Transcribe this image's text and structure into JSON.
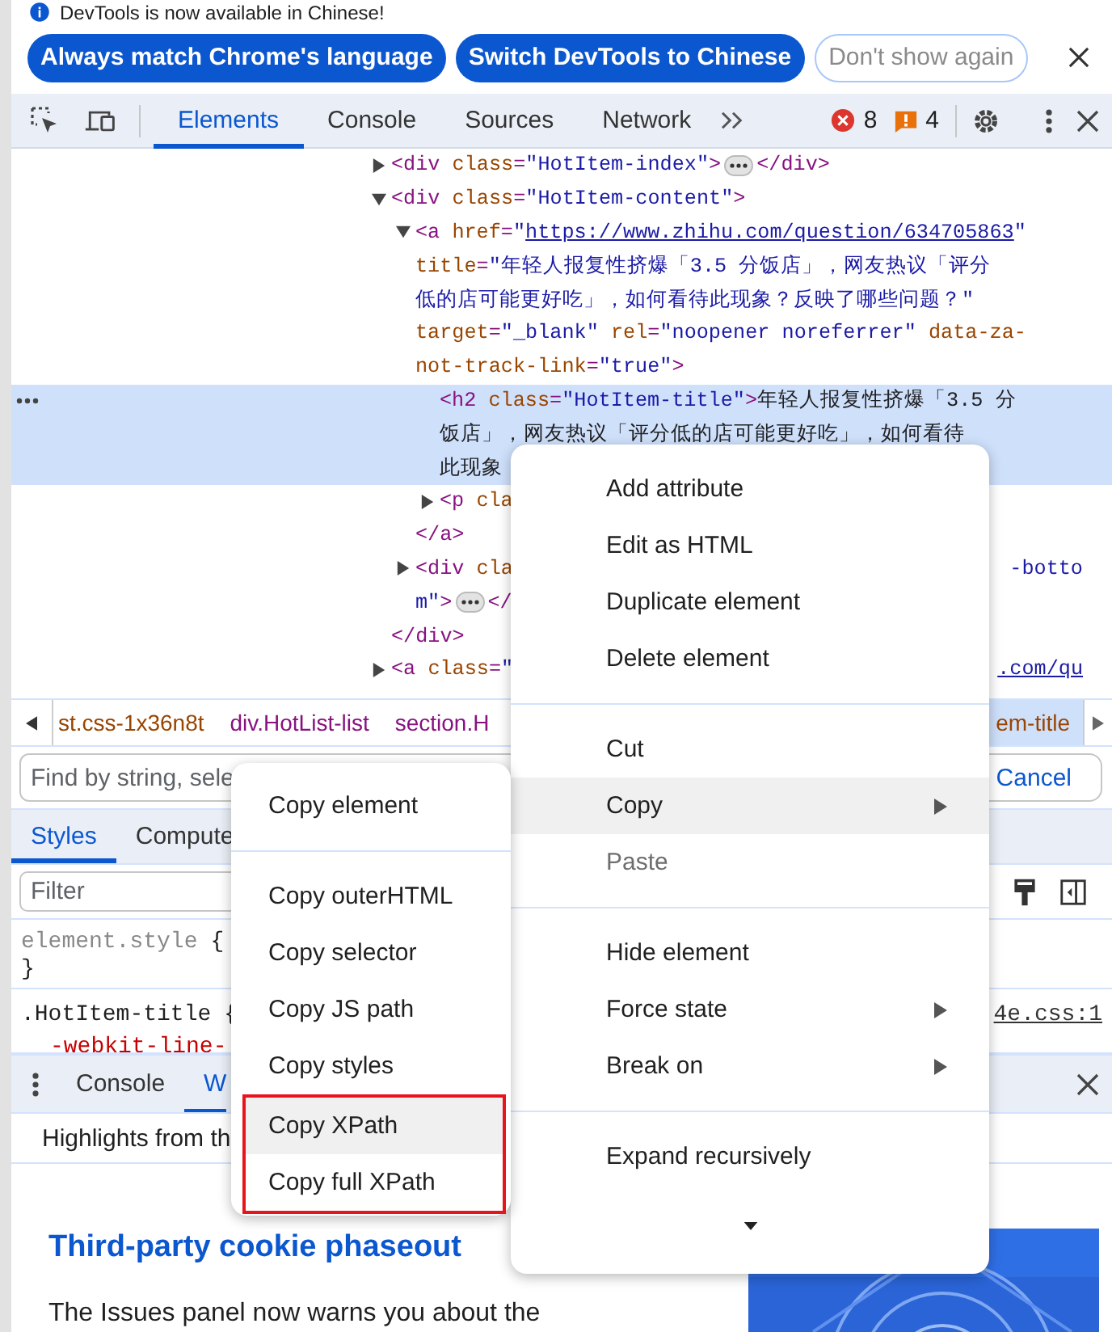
{
  "banner": {
    "message": "DevTools is now available in Chinese!",
    "buttons": [
      {
        "label": "Always match Chrome's language",
        "kind": "primary"
      },
      {
        "label": "Switch DevTools to Chinese",
        "kind": "primary"
      },
      {
        "label": "Don't show again",
        "kind": "secondary"
      }
    ]
  },
  "toolbar": {
    "tabs": [
      {
        "label": "Elements",
        "selected": true
      },
      {
        "label": "Console",
        "selected": false
      },
      {
        "label": "Sources",
        "selected": false
      },
      {
        "label": "Network",
        "selected": false
      }
    ],
    "errors": "8",
    "warnings": "4"
  },
  "dom_tree": [
    {
      "expanded": false,
      "selected": false,
      "open": [
        {
          "segments": [
            {
              "kind": "code",
              "tokens": [
                {
                  "kind": "tag",
                  "text": "<div "
                },
                {
                  "kind": "attr",
                  "text": "class"
                },
                {
                  "kind": "tag",
                  "text": "="
                },
                {
                  "kind": "value",
                  "text": "\"HotItem-index\""
                },
                {
                  "kind": "tag",
                  "text": ">"
                }
              ]
            },
            {
              "kind": "ellipsis"
            },
            {
              "kind": "code",
              "tokens": [
                {
                  "kind": "tag",
                  "text": "</div>"
                }
              ]
            }
          ]
        }
      ]
    },
    {
      "expanded": true,
      "selected": false,
      "open": [
        {
          "segments": [
            {
              "kind": "code",
              "tokens": [
                {
                  "kind": "tag",
                  "text": "<div "
                },
                {
                  "kind": "attr",
                  "text": "class"
                },
                {
                  "kind": "tag",
                  "text": "="
                },
                {
                  "kind": "value",
                  "text": "\"HotItem-content\""
                },
                {
                  "kind": "tag",
                  "text": ">"
                }
              ]
            }
          ]
        }
      ],
      "children": [
        {
          "expanded": true,
          "selected": false,
          "open": [
            {
              "segments": [
                {
                  "kind": "code",
                  "tokens": [
                    {
                      "kind": "tag",
                      "text": "<a "
                    },
                    {
                      "kind": "attr",
                      "text": "href"
                    },
                    {
                      "kind": "tag",
                      "text": "="
                    },
                    {
                      "kind": "value",
                      "text": "\""
                    },
                    {
                      "kind": "link",
                      "text": "https://www.zhihu.com/question/634705863"
                    },
                    {
                      "kind": "value",
                      "text": "\""
                    }
                  ]
                }
              ]
            },
            {
              "segments": [
                {
                  "kind": "code",
                  "tokens": [
                    {
                      "kind": "attr",
                      "text": "title"
                    },
                    {
                      "kind": "tag",
                      "text": "="
                    },
                    {
                      "kind": "value",
                      "text": "\"年轻人报复性挤爆「3.5 分饭店」，网友热议「评分"
                    }
                  ]
                }
              ]
            },
            {
              "segments": [
                {
                  "kind": "code",
                  "tokens": [
                    {
                      "kind": "value",
                      "text": "低的店可能更好吃」，如何看待此现象？反映了哪些问题？\""
                    }
                  ]
                }
              ]
            },
            {
              "segments": [
                {
                  "kind": "code",
                  "tokens": [
                    {
                      "kind": "attr",
                      "text": "target"
                    },
                    {
                      "kind": "tag",
                      "text": "="
                    },
                    {
                      "kind": "value",
                      "text": "\"_blank\" "
                    },
                    {
                      "kind": "attr",
                      "text": "rel"
                    },
                    {
                      "kind": "tag",
                      "text": "="
                    },
                    {
                      "kind": "value",
                      "text": "\"noopener noreferrer\" "
                    },
                    {
                      "kind": "attr",
                      "text": "data-za-"
                    }
                  ]
                }
              ]
            },
            {
              "segments": [
                {
                  "kind": "code",
                  "tokens": [
                    {
                      "kind": "attr",
                      "text": "not-track-link"
                    },
                    {
                      "kind": "tag",
                      "text": "="
                    },
                    {
                      "kind": "value",
                      "text": "\"true\""
                    },
                    {
                      "kind": "tag",
                      "text": ">"
                    }
                  ]
                }
              ]
            }
          ],
          "children": [
            {
              "selected": true,
              "open": [
                {
                  "segments": [
                    {
                      "kind": "code",
                      "tokens": [
                        {
                          "kind": "tag",
                          "text": "<h2 "
                        },
                        {
                          "kind": "attr",
                          "text": "class"
                        },
                        {
                          "kind": "tag",
                          "text": "="
                        },
                        {
                          "kind": "value",
                          "text": "\"HotItem-title\""
                        },
                        {
                          "kind": "tag",
                          "text": ">"
                        },
                        {
                          "kind": "text",
                          "text": "年轻人报复性挤爆「3.5 分"
                        }
                      ]
                    }
                  ]
                },
                {
                  "segments": [
                    {
                      "kind": "code",
                      "tokens": [
                        {
                          "kind": "text",
                          "text": "饭店」，网友热议「评分低的店可能更好吃」，如何看待"
                        }
                      ]
                    }
                  ]
                },
                {
                  "segments": [
                    {
                      "kind": "code",
                      "tokens": [
                        {
                          "kind": "text",
                          "text": "此现象"
                        }
                      ]
                    }
                  ]
                }
              ]
            },
            {
              "expanded": false,
              "selected": false,
              "open": [
                {
                  "segments": [
                    {
                      "kind": "code",
                      "tokens": [
                        {
                          "kind": "tag",
                          "text": "<p "
                        },
                        {
                          "kind": "attr",
                          "text": "cla"
                        }
                      ]
                    }
                  ]
                }
              ]
            }
          ],
          "close": {
            "segments": [
              {
                "kind": "code",
                "tokens": [
                  {
                    "kind": "tag",
                    "text": "</a>"
                  }
                ]
              }
            ]
          }
        },
        {
          "expanded": false,
          "selected": false,
          "open": [
            {
              "segments": [
                {
                  "kind": "code",
                  "tokens": [
                    {
                      "kind": "tag",
                      "text": "<div "
                    },
                    {
                      "kind": "attr",
                      "text": "cla"
                    }
                  ]
                }
              ],
              "tail": [
                {
                  "kind": "value",
                  "text": "-botto"
                }
              ]
            },
            {
              "segments": [
                {
                  "kind": "code",
                  "tokens": [
                    {
                      "kind": "value",
                      "text": "m\""
                    },
                    {
                      "kind": "tag",
                      "text": ">"
                    }
                  ]
                },
                {
                  "kind": "ellipsis"
                },
                {
                  "kind": "code",
                  "tokens": [
                    {
                      "kind": "tag",
                      "text": "</"
                    }
                  ]
                }
              ]
            }
          ]
        }
      ],
      "close": {
        "segments": [
          {
            "kind": "code",
            "tokens": [
              {
                "kind": "tag",
                "text": "</div>"
              }
            ]
          }
        ]
      }
    },
    {
      "expanded": false,
      "selected": false,
      "open": [
        {
          "segments": [
            {
              "kind": "code",
              "tokens": [
                {
                  "kind": "tag",
                  "text": "<a "
                },
                {
                  "kind": "attr",
                  "text": "class"
                },
                {
                  "kind": "tag",
                  "text": "="
                },
                {
                  "kind": "value",
                  "text": "\""
                }
              ]
            }
          ],
          "tail": [
            {
              "kind": "link",
              "text": ".com/qu"
            }
          ]
        }
      ]
    }
  ],
  "breadcrumbs": [
    {
      "text": "st.css-1x36n8t",
      "kind": "class",
      "selected": false
    },
    {
      "text": "div.HotList-list",
      "kind": "tag",
      "selected": false
    },
    {
      "text": "section.H",
      "kind": "tag",
      "selected": false
    },
    {
      "text": "em-title",
      "kind": "class",
      "selected": true
    }
  ],
  "search": {
    "placeholder": "Find by string, sele",
    "cancel": "Cancel"
  },
  "sidebar": {
    "tabs": [
      {
        "label": "Styles",
        "selected": true
      },
      {
        "label": "Compute",
        "selected": false
      }
    ],
    "filter_placeholder": "Filter",
    "rules": [
      {
        "kind": "inline",
        "selector": "element.style",
        "open": "{",
        "close": "}"
      },
      {
        "kind": "matched",
        "selector": ".HotItem-title",
        "open": "{",
        "source": "4e.css:1",
        "declarations": [
          "-webkit-line-"
        ]
      }
    ]
  },
  "drawer": {
    "tabs": [
      {
        "label": "Console",
        "selected": false
      },
      {
        "label": "W",
        "selected": true
      }
    ],
    "highlights": "Highlights from th",
    "heading": "Third-party cookie phaseout",
    "paragraph": "The Issues panel now warns you about the"
  },
  "context_menu": {
    "items": [
      {
        "kind": "item",
        "label": "Add attribute",
        "highlighted": false,
        "disabled": false,
        "submenu": false
      },
      {
        "kind": "item",
        "label": "Edit as HTML",
        "highlighted": false,
        "disabled": false,
        "submenu": false
      },
      {
        "kind": "item",
        "label": "Duplicate element",
        "highlighted": false,
        "disabled": false,
        "submenu": false
      },
      {
        "kind": "item",
        "label": "Delete element",
        "highlighted": false,
        "disabled": false,
        "submenu": false
      },
      {
        "kind": "separator"
      },
      {
        "kind": "item",
        "label": "Cut",
        "highlighted": false,
        "disabled": false,
        "submenu": false
      },
      {
        "kind": "item",
        "label": "Copy",
        "highlighted": true,
        "disabled": false,
        "submenu": true
      },
      {
        "kind": "item",
        "label": "Paste",
        "highlighted": false,
        "disabled": true,
        "submenu": false
      },
      {
        "kind": "separator"
      },
      {
        "kind": "item",
        "label": "Hide element",
        "highlighted": false,
        "disabled": false,
        "submenu": false
      },
      {
        "kind": "item",
        "label": "Force state",
        "highlighted": false,
        "disabled": false,
        "submenu": true
      },
      {
        "kind": "item",
        "label": "Break on",
        "highlighted": false,
        "disabled": false,
        "submenu": true
      },
      {
        "kind": "separator"
      },
      {
        "kind": "item",
        "label": "Expand recursively",
        "highlighted": false,
        "disabled": false,
        "submenu": false
      },
      {
        "kind": "scroll"
      }
    ]
  },
  "copy_submenu": {
    "items": [
      {
        "kind": "item",
        "label": "Copy element",
        "highlighted": false,
        "boxed": false
      },
      {
        "kind": "separator"
      },
      {
        "kind": "item",
        "label": "Copy outerHTML",
        "highlighted": false,
        "boxed": false
      },
      {
        "kind": "item",
        "label": "Copy selector",
        "highlighted": false,
        "boxed": false
      },
      {
        "kind": "item",
        "label": "Copy JS path",
        "highlighted": false,
        "boxed": false
      },
      {
        "kind": "item",
        "label": "Copy styles",
        "highlighted": false,
        "boxed": false
      },
      {
        "kind": "item",
        "label": "Copy XPath",
        "highlighted": true,
        "boxed": true
      },
      {
        "kind": "item",
        "label": "Copy full XPath",
        "highlighted": false,
        "boxed": true
      }
    ]
  }
}
